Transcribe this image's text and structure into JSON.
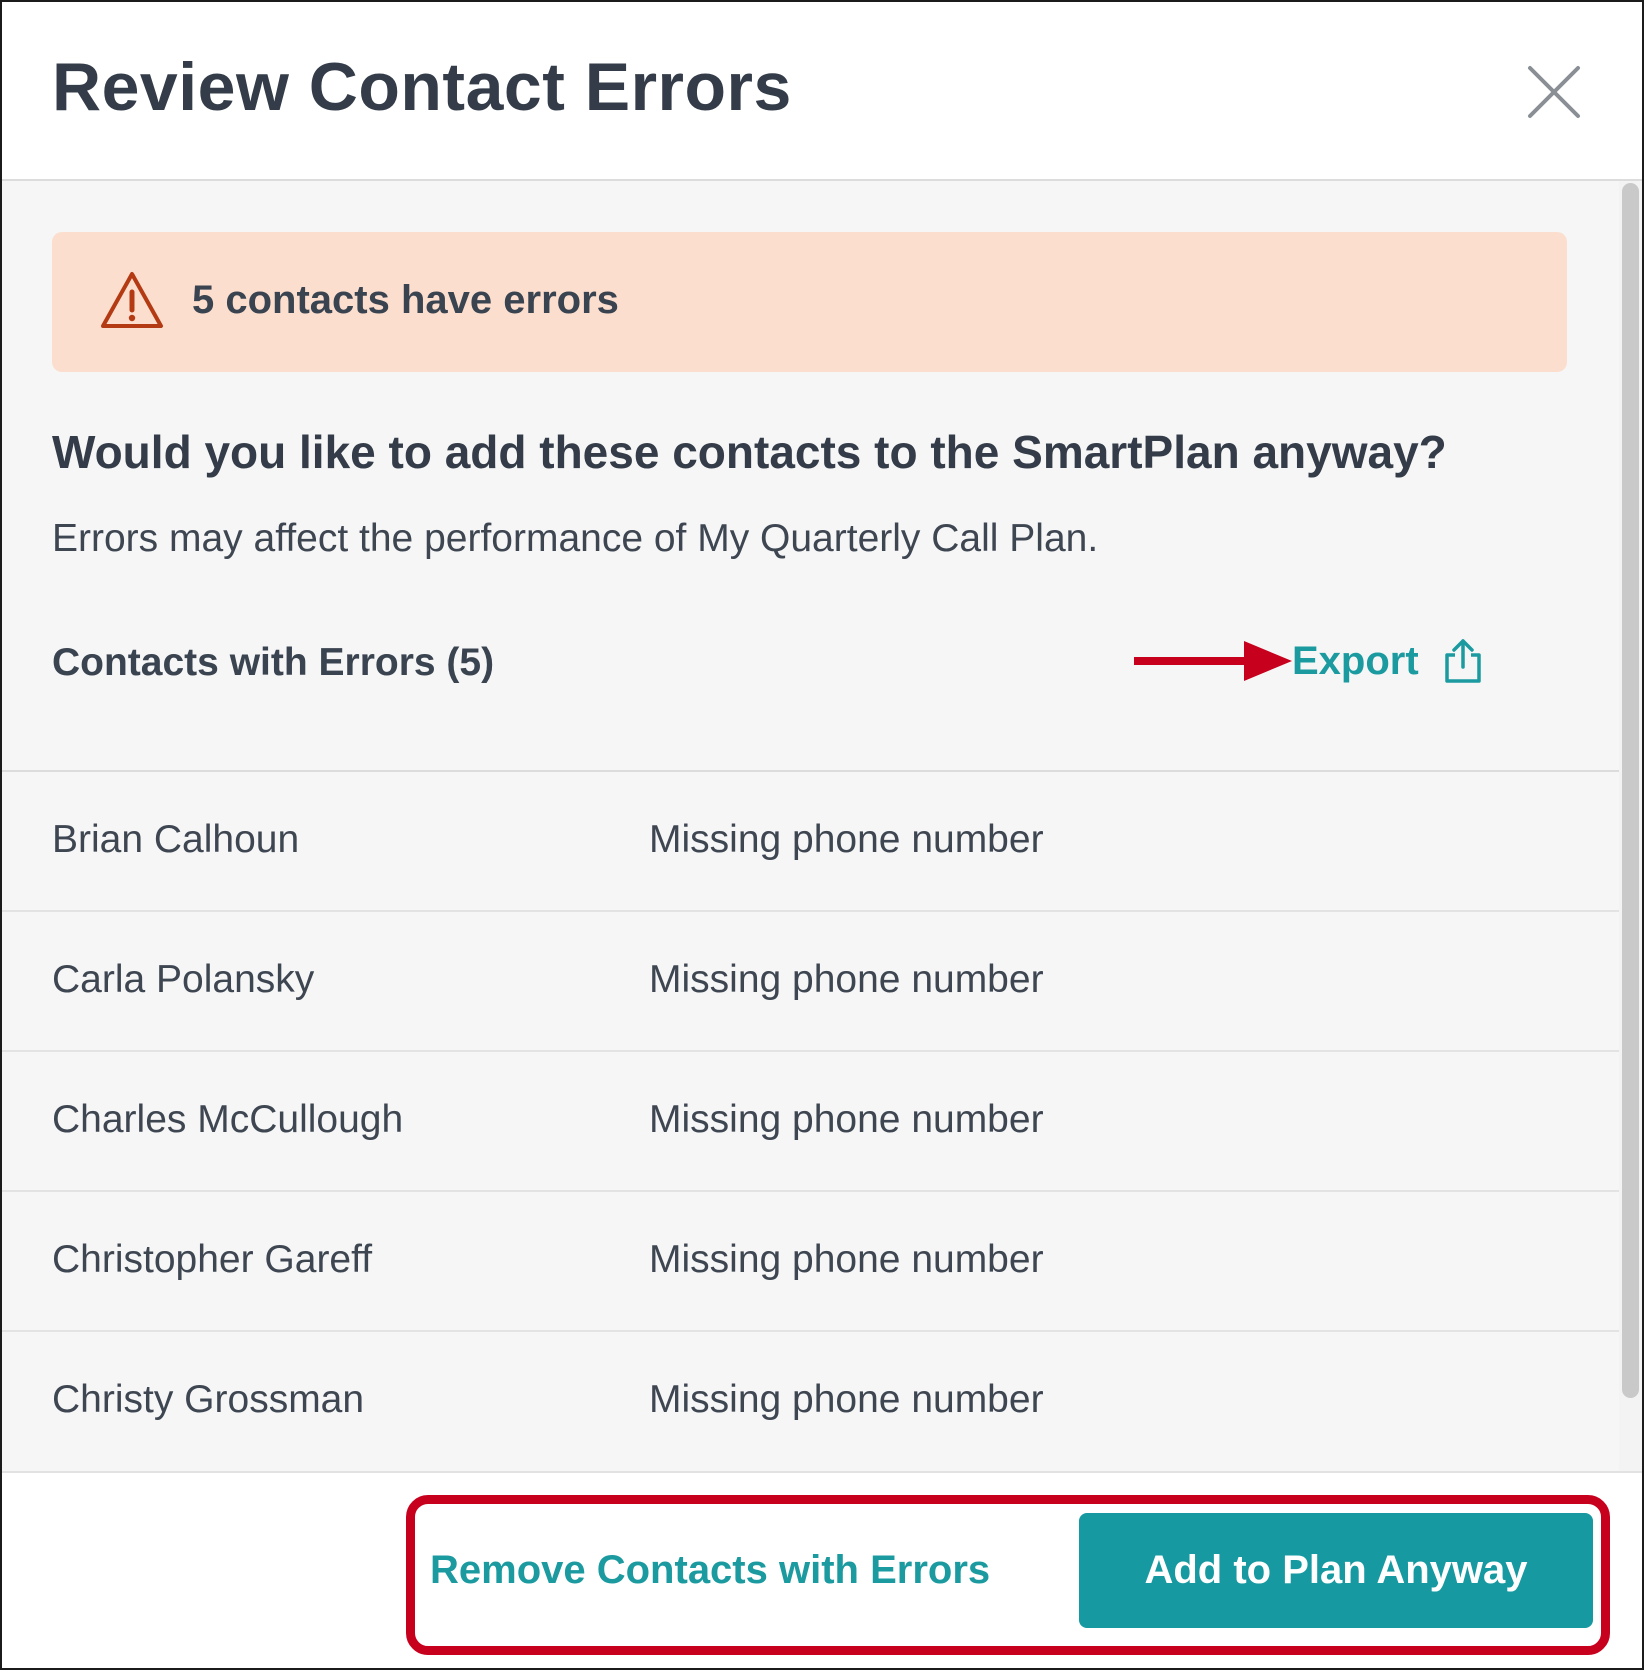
{
  "dialog": {
    "title": "Review Contact Errors",
    "close_icon": "close-icon"
  },
  "alert": {
    "icon": "warning-triangle-icon",
    "text": "5 contacts have errors",
    "background_color": "#fcdece",
    "icon_color": "#b33a12"
  },
  "prompt": {
    "question": "Would you like to add these contacts to the SmartPlan anyway?",
    "description": "Errors may affect the performance of My Quarterly Call Plan."
  },
  "contacts_section": {
    "label": "Contacts with Errors (5)",
    "export_label": "Export",
    "export_icon": "share-export-icon",
    "rows": [
      {
        "name": "Brian Calhoun",
        "error": "Missing phone number"
      },
      {
        "name": "Carla Polansky",
        "error": "Missing phone number"
      },
      {
        "name": "Charles McCullough",
        "error": "Missing phone number"
      },
      {
        "name": "Christopher Gareff",
        "error": "Missing phone number"
      },
      {
        "name": "Christy Grossman",
        "error": "Missing phone number"
      }
    ]
  },
  "footer": {
    "remove_label": "Remove Contacts with Errors",
    "add_label": "Add to Plan Anyway"
  },
  "colors": {
    "accent": "#1699a0",
    "annotation": "#c7001e",
    "text_dark": "#333c48"
  }
}
